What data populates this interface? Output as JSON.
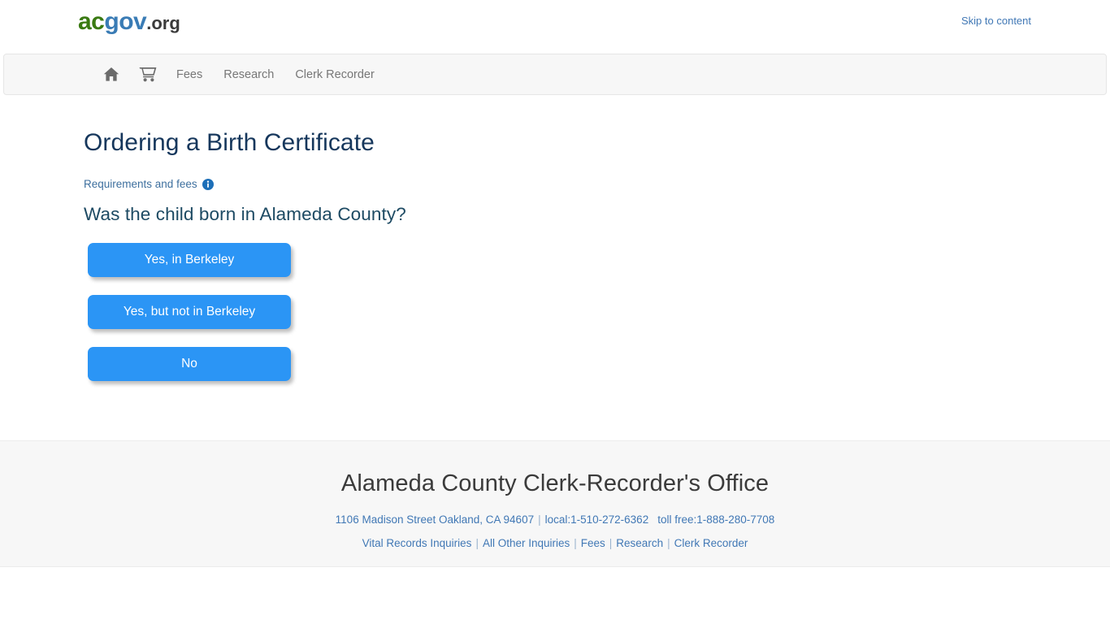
{
  "header": {
    "logo": {
      "part1": "ac",
      "part2": "gov",
      "part3": ".org"
    },
    "skip_link": "Skip to content",
    "accent_blue": "#4178b5",
    "logo_green": "#3a7a12",
    "logo_blue": "#3a7cb5"
  },
  "nav": {
    "items": [
      {
        "icon": "home-icon",
        "label": ""
      },
      {
        "icon": "shopping-cart-icon",
        "label": ""
      },
      {
        "icon": "",
        "label": "Fees"
      },
      {
        "icon": "",
        "label": "Research"
      },
      {
        "icon": "",
        "label": "Clerk Recorder"
      }
    ]
  },
  "main": {
    "page_title": "Ordering a Birth Certificate",
    "requirements_link": "Requirements and fees",
    "info_icon": "info-circle-icon",
    "question": "Was the child born in Alameda County?",
    "button_color": "#2b95f5",
    "choices": [
      {
        "label": "Yes, in Berkeley"
      },
      {
        "label": "Yes, but not in Berkeley"
      },
      {
        "label": "No"
      }
    ]
  },
  "footer": {
    "title": "Alameda County Clerk-Recorder's Office",
    "address": "1106 Madison Street Oakland, CA 94607",
    "separator": "|",
    "local_phone": "local:1-510-272-6362",
    "toll_free_phone": "toll free:1-888-280-7708",
    "links": [
      {
        "label": "Vital Records Inquiries"
      },
      {
        "label": "All Other Inquiries"
      },
      {
        "label": "Fees"
      },
      {
        "label": "Research"
      },
      {
        "label": "Clerk Recorder"
      }
    ]
  }
}
